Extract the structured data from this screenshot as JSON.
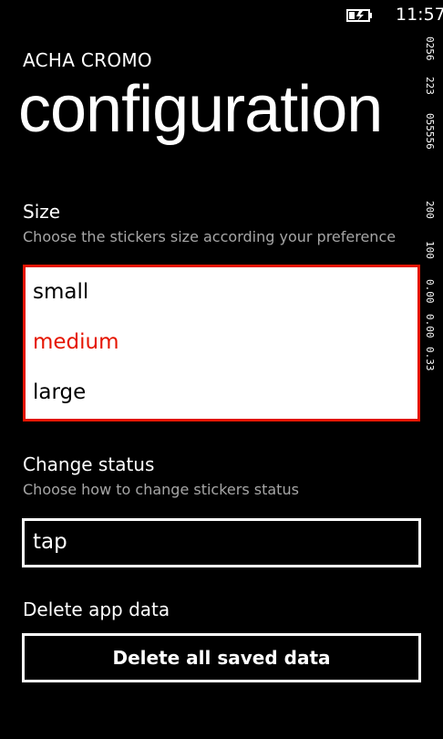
{
  "status_bar": {
    "time": "11:57",
    "battery_icon": "battery-charging-icon"
  },
  "header": {
    "app_name": "ACHA CROMO",
    "page_title": "configuration"
  },
  "size_section": {
    "title": "Size",
    "description": "Choose the stickers size according your preference",
    "options": [
      "small",
      "medium",
      "large"
    ],
    "selected": "medium"
  },
  "status_section": {
    "title": "Change status",
    "description": "Choose how to change stickers status",
    "value": "tap"
  },
  "delete_section": {
    "title": "Delete app data",
    "button_label": "Delete all saved data"
  },
  "debug_counter": {
    "values": [
      "0256",
      "223",
      "055556",
      "200",
      "100",
      "0.00",
      "0.00",
      "0.33"
    ]
  },
  "colors": {
    "accent": "#e51400",
    "background": "#000000",
    "foreground": "#ffffff",
    "subtle": "#a6a6a6"
  }
}
